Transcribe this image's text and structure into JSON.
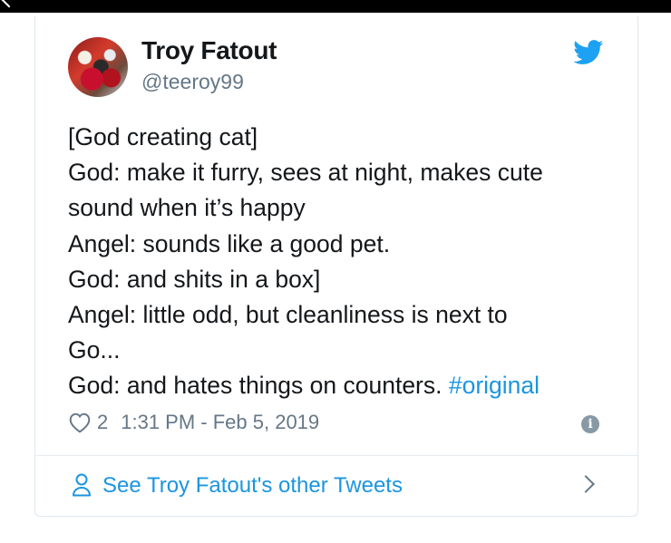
{
  "author": {
    "name": "Troy Fatout",
    "handle": "@teeroy99"
  },
  "tweet": {
    "lines": [
      "[God creating cat]",
      "God:  make it furry, sees at night, makes cute",
      "sound when it’s happy",
      "Angel:  sounds like a good pet.",
      "God:  and shits in a box]",
      "Angel:  little odd, but cleanliness is next to",
      "Go...",
      "God:  and hates things on counters. "
    ],
    "hashtag": "#original",
    "likes": "2",
    "timestamp": "1:31 PM - Feb 5, 2019"
  },
  "footer": {
    "label": "See Troy Fatout's other Tweets"
  },
  "colors": {
    "accent": "#1b95e0",
    "muted": "#657786",
    "twitter_blue": "#1da1f2"
  },
  "icons": [
    "twitter-bird-icon",
    "heart-icon",
    "info-icon",
    "person-icon",
    "chevron-right-icon",
    "back-chevron-icon"
  ]
}
